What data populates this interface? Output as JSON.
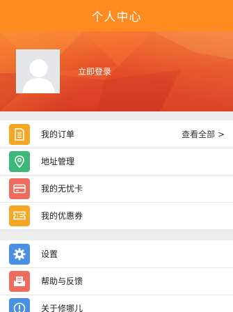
{
  "header": {
    "title": "个人中心"
  },
  "profile": {
    "login_label": "立即登录"
  },
  "menu_primary": [
    {
      "label": "我的订单",
      "icon": "order-document-icon",
      "color": "#f5a623"
    },
    {
      "label": "地址管理",
      "icon": "location-pin-icon",
      "color": "#3cb878"
    },
    {
      "label": "我的无忧卡",
      "icon": "card-icon",
      "color": "#ef6b5e"
    },
    {
      "label": "我的优惠券",
      "icon": "coupon-icon",
      "color": "#f5a623"
    }
  ],
  "orders_link": "查看全部 >",
  "menu_secondary": [
    {
      "label": "设置",
      "icon": "gear-icon",
      "color": "#4a90e2"
    },
    {
      "label": "帮助与反馈",
      "icon": "feedback-envelope-icon",
      "color": "#ef6b5e"
    },
    {
      "label": "关于修哪儿",
      "icon": "info-icon",
      "color": "#4a90e2"
    }
  ],
  "colors": {
    "header": "#ff8a1f",
    "profile_bg": "#e34a28",
    "page_bg": "#ececec"
  }
}
